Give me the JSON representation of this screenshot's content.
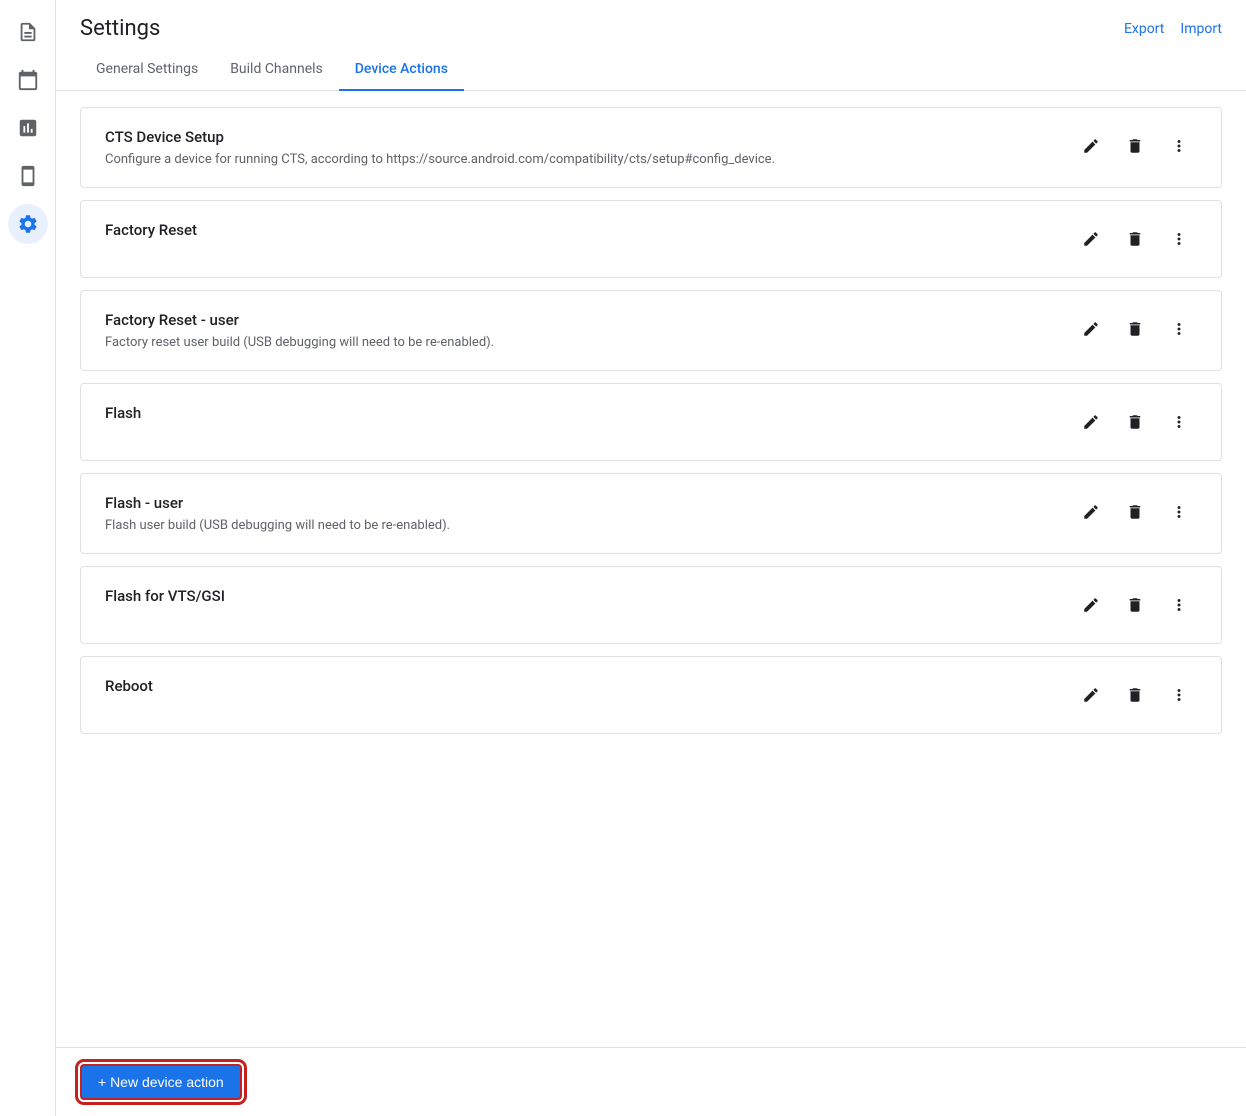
{
  "page": {
    "title": "Settings"
  },
  "header": {
    "export_label": "Export",
    "import_label": "Import"
  },
  "tabs": [
    {
      "id": "general",
      "label": "General Settings",
      "active": false
    },
    {
      "id": "build-channels",
      "label": "Build Channels",
      "active": false
    },
    {
      "id": "device-actions",
      "label": "Device Actions",
      "active": true
    }
  ],
  "sidebar": {
    "items": [
      {
        "id": "reports",
        "icon": "reports",
        "active": false
      },
      {
        "id": "schedule",
        "icon": "schedule",
        "active": false
      },
      {
        "id": "analytics",
        "icon": "analytics",
        "active": false
      },
      {
        "id": "devices",
        "icon": "devices",
        "active": false
      },
      {
        "id": "settings",
        "icon": "settings",
        "active": true
      }
    ]
  },
  "actions": [
    {
      "id": "cts-device-setup",
      "name": "CTS Device Setup",
      "description": "Configure a device for running CTS, according to https://source.android.com/compatibility/cts/setup#config_device."
    },
    {
      "id": "factory-reset",
      "name": "Factory Reset",
      "description": ""
    },
    {
      "id": "factory-reset-user",
      "name": "Factory Reset - user",
      "description": "Factory reset user build (USB debugging will need to be re-enabled)."
    },
    {
      "id": "flash",
      "name": "Flash",
      "description": ""
    },
    {
      "id": "flash-user",
      "name": "Flash - user",
      "description": "Flash user build (USB debugging will need to be re-enabled)."
    },
    {
      "id": "flash-vts-gsi",
      "name": "Flash for VTS/GSI",
      "description": ""
    },
    {
      "id": "reboot",
      "name": "Reboot",
      "description": ""
    }
  ],
  "footer": {
    "new_action_label": "+ New device action"
  }
}
